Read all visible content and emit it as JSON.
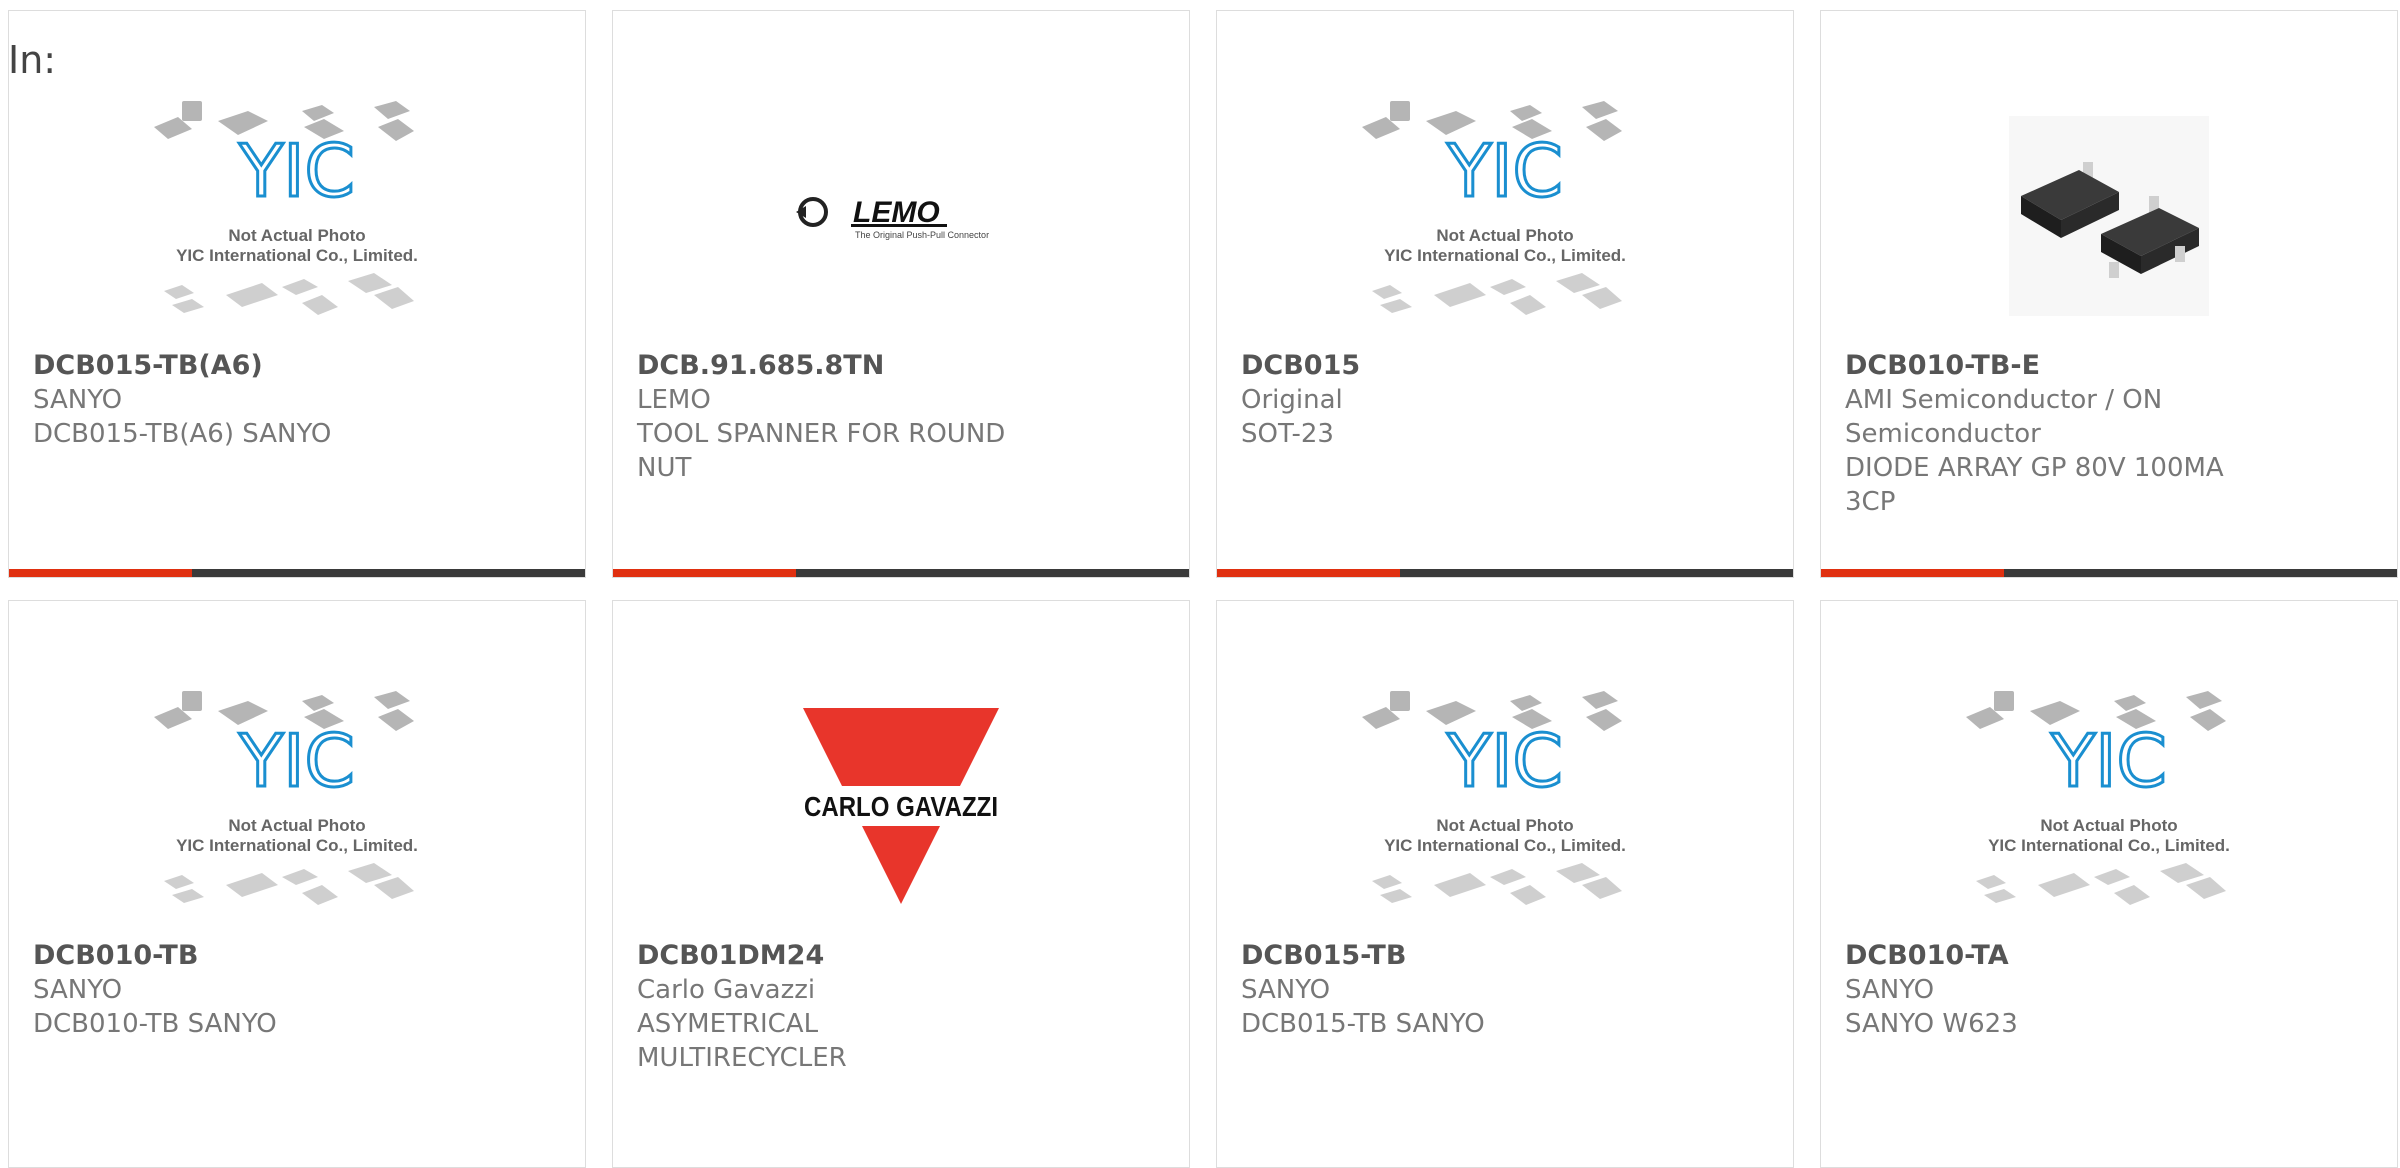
{
  "header": {
    "in_label": "In:"
  },
  "placeholder": {
    "line1": "Not Actual Photo",
    "line2": "YIC International Co., Limited.",
    "logo": "YIC"
  },
  "lemo": {
    "logo": "LEMO",
    "tagline": "The Original Push-Pull Connector"
  },
  "carlo": {
    "logo": "CARLO GAVAZZI"
  },
  "colors": {
    "accent": "#e03010",
    "bar": "#3a3a3a",
    "yic_blue": "#1a8fd0",
    "carlo_red": "#e8352b"
  },
  "products": [
    {
      "part": "DCB015-TB(A6)",
      "maker": "SANYO",
      "desc": "DCB015-TB(A6) SANYO",
      "image": "yic-placeholder"
    },
    {
      "part": "DCB.91.685.8TN",
      "maker": "LEMO",
      "desc": "TOOL SPANNER FOR ROUND NUT",
      "image": "lemo-logo"
    },
    {
      "part": "DCB015",
      "maker": "Original",
      "desc": "SOT-23",
      "image": "yic-placeholder"
    },
    {
      "part": "DCB010-TB-E",
      "maker": "AMI Semiconductor / ON Semiconductor",
      "desc": "DIODE ARRAY GP 80V 100MA 3CP",
      "image": "sot23-photo"
    },
    {
      "part": "DCB010-TB",
      "maker": "SANYO",
      "desc": "DCB010-TB SANYO",
      "image": "yic-placeholder"
    },
    {
      "part": "DCB01DM24",
      "maker": "Carlo Gavazzi",
      "desc": "ASYMETRICAL MULTIRECYCLER",
      "image": "carlo-gavazzi-logo"
    },
    {
      "part": "DCB015-TB",
      "maker": "SANYO",
      "desc": "DCB015-TB SANYO",
      "image": "yic-placeholder"
    },
    {
      "part": "DCB010-TA",
      "maker": "SANYO",
      "desc": "SANYO W623",
      "image": "yic-placeholder"
    }
  ]
}
